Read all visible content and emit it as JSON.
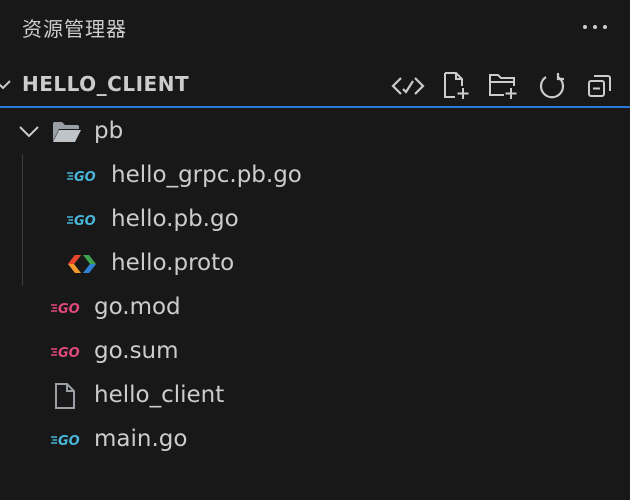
{
  "explorer": {
    "title": "资源管理器",
    "section": "HELLO_CLIENT",
    "actions": [
      "link-icon",
      "new-file-icon",
      "new-folder-icon",
      "refresh-icon",
      "collapse-all-icon"
    ]
  },
  "tree": {
    "folder": {
      "label": "pb",
      "icon": "folder-open-icon"
    },
    "children": [
      {
        "label": "hello_grpc.pb.go",
        "icon": "go-icon"
      },
      {
        "label": "hello.pb.go",
        "icon": "go-icon"
      },
      {
        "label": "hello.proto",
        "icon": "proto-icon"
      }
    ],
    "files": [
      {
        "label": "go.mod",
        "icon": "go-mod-icon"
      },
      {
        "label": "go.sum",
        "icon": "go-mod-icon"
      },
      {
        "label": "hello_client",
        "icon": "file-icon"
      },
      {
        "label": "main.go",
        "icon": "go-icon"
      }
    ]
  },
  "colors": {
    "background": "#181818",
    "text": "#cccccc",
    "focus_border": "#2b79d6",
    "go_blue": "#49b6d9",
    "go_mod_pink": "#e2487a"
  }
}
